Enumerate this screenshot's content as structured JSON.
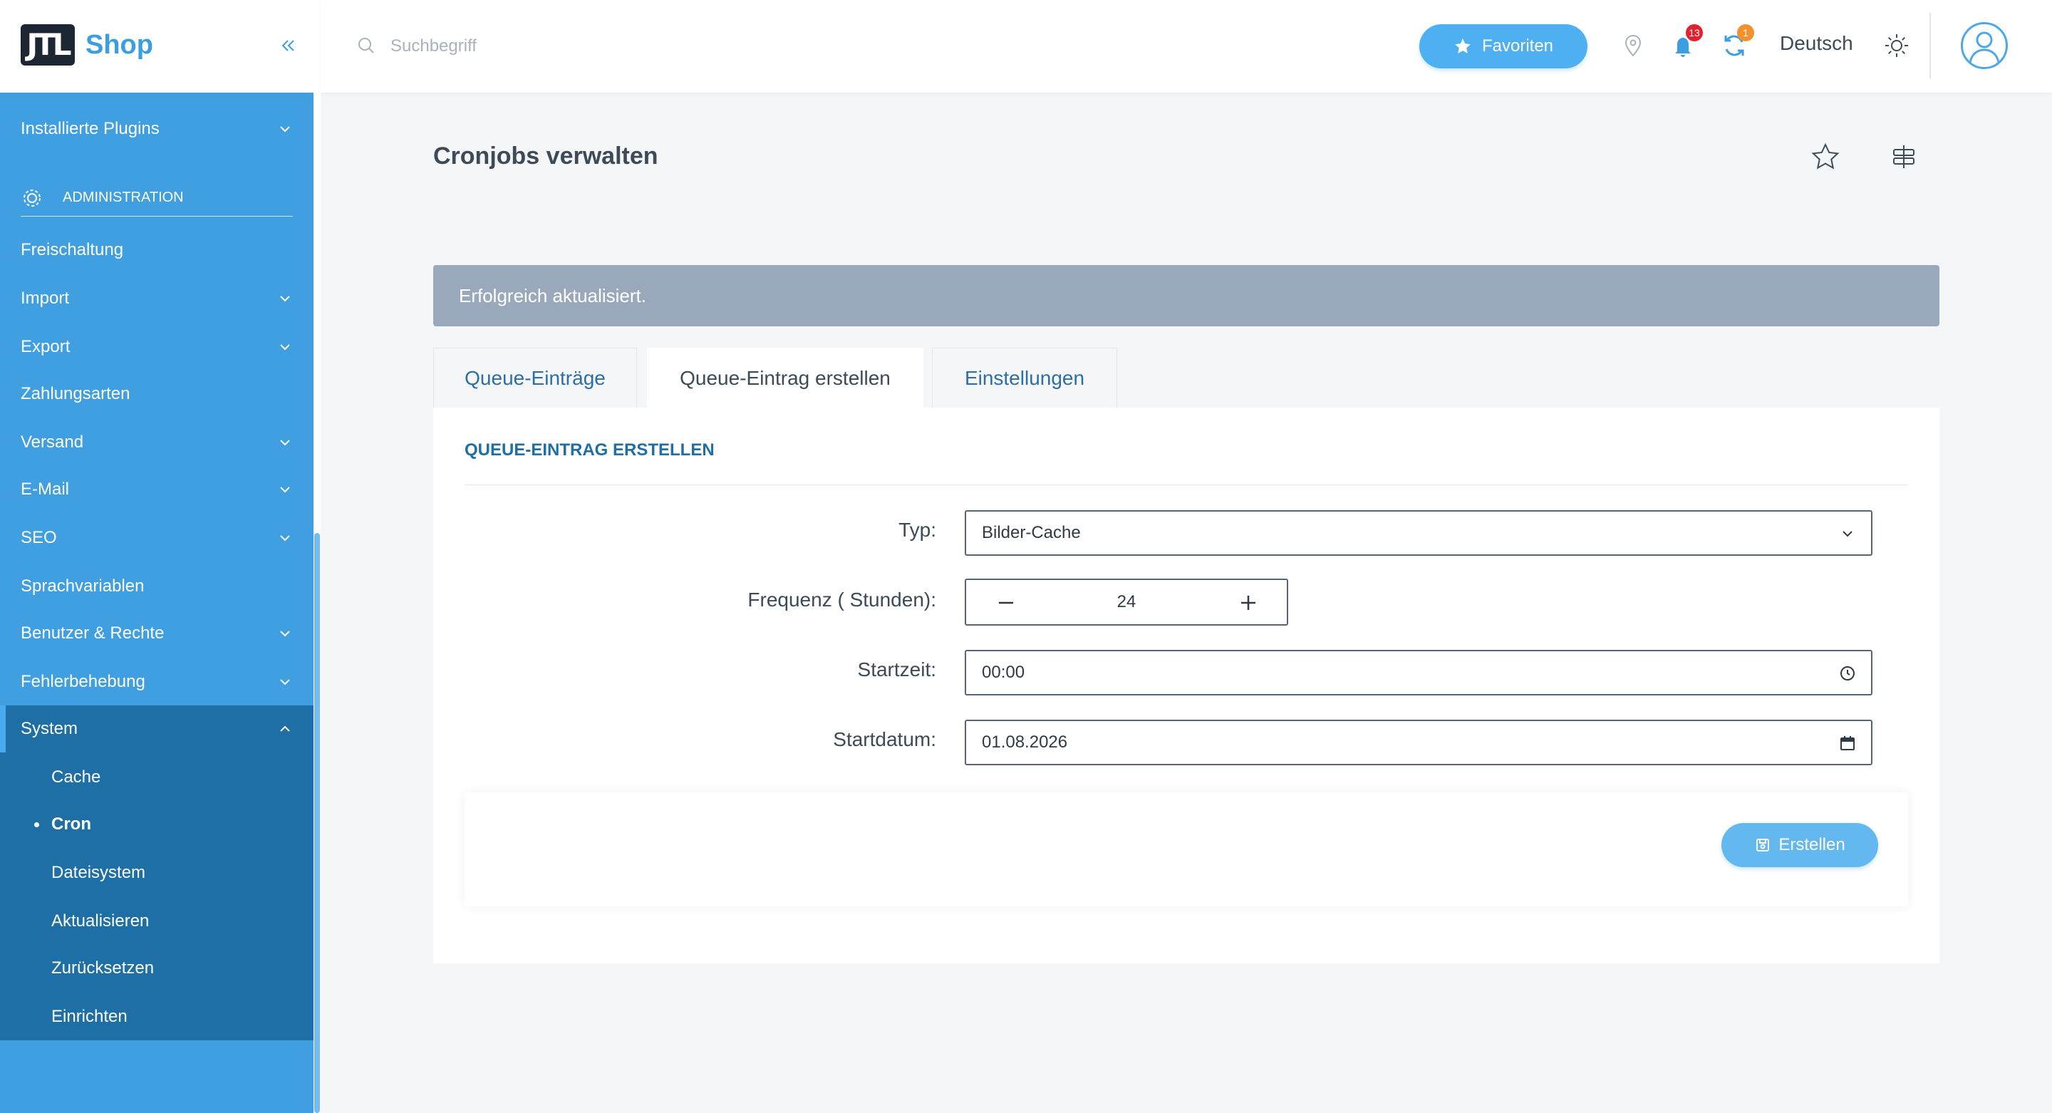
{
  "brand": {
    "logo_text": "JTL",
    "name": "Shop"
  },
  "search": {
    "placeholder": "Suchbegriff"
  },
  "topbar": {
    "favorites_label": "Favoriten",
    "notifications_count": "13",
    "updates_count": "1",
    "language": "Deutsch"
  },
  "sidebar": {
    "top_item": "Installierte Plugins",
    "section": "ADMINISTRATION",
    "items": [
      {
        "label": "Freischaltung",
        "has_children": false
      },
      {
        "label": "Import",
        "has_children": true
      },
      {
        "label": "Export",
        "has_children": true
      },
      {
        "label": "Zahlungsarten",
        "has_children": false
      },
      {
        "label": "Versand",
        "has_children": true
      },
      {
        "label": "E-Mail",
        "has_children": true
      },
      {
        "label": "SEO",
        "has_children": true
      },
      {
        "label": "Sprachvariablen",
        "has_children": false
      },
      {
        "label": "Benutzer & Rechte",
        "has_children": true
      },
      {
        "label": "Fehlerbehebung",
        "has_children": true
      },
      {
        "label": "System",
        "has_children": true,
        "expanded": true
      }
    ],
    "sub_items": [
      {
        "label": "Cache",
        "active": false
      },
      {
        "label": "Cron",
        "active": true
      },
      {
        "label": "Dateisystem",
        "active": false
      },
      {
        "label": "Aktualisieren",
        "active": false
      },
      {
        "label": "Zurücksetzen",
        "active": false
      },
      {
        "label": "Einrichten",
        "active": false
      }
    ]
  },
  "page": {
    "title": "Cronjobs verwalten",
    "alert": "Erfolgreich aktualisiert.",
    "tabs": [
      {
        "label": "Queue-Einträge",
        "active": false
      },
      {
        "label": "Queue-Eintrag erstellen",
        "active": true
      },
      {
        "label": "Einstellungen",
        "active": false
      }
    ]
  },
  "form": {
    "heading": "QUEUE-EINTRAG ERSTELLEN",
    "type_label": "Typ:",
    "type_value": "Bilder-Cache",
    "frequency_label": "Frequenz ( Stunden):",
    "frequency_value": "24",
    "start_time_label": "Startzeit:",
    "start_time_value": "00:00",
    "start_date_label": "Startdatum:",
    "start_date_value": "01.08.2026",
    "submit_label": "Erstellen"
  },
  "colors": {
    "sidebar": "#3f9fe0",
    "sidebar_active": "#1d6fa5",
    "accent": "#4eb0f0",
    "alert": "#99a9bb",
    "badge_red": "#e5202e",
    "badge_orange": "#f3912d"
  },
  "icons": {
    "collapse": "double-chevron-left-icon",
    "search": "search-icon",
    "favorites": "star-icon",
    "location": "map-pin-icon",
    "notifications": "bell-icon",
    "updates": "refresh-icon",
    "theme": "sun-icon",
    "user": "user-avatar-icon"
  }
}
